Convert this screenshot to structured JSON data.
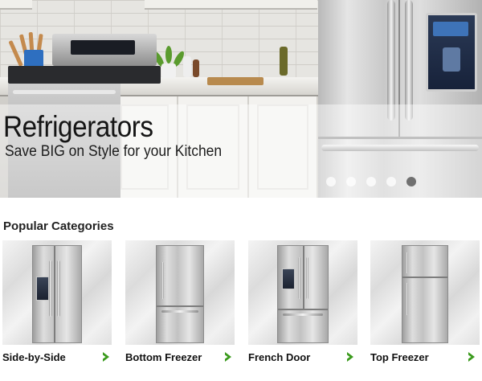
{
  "hero": {
    "title": "Refrigerators",
    "subtitle": "Save BIG on Style for your Kitchen",
    "slides_total": 5,
    "active_slide": 5
  },
  "categories": {
    "title": "Popular Categories",
    "items": [
      {
        "label": "Side-by-Side",
        "icon": "chevron-right-icon"
      },
      {
        "label": "Bottom Freezer",
        "icon": "chevron-right-icon"
      },
      {
        "label": "French Door",
        "icon": "chevron-right-icon"
      },
      {
        "label": "Top Freezer",
        "icon": "chevron-right-icon"
      }
    ]
  },
  "colors": {
    "accent_chevron": "#3a9a1c",
    "title_text": "#151515",
    "dot_active": "#707070"
  }
}
